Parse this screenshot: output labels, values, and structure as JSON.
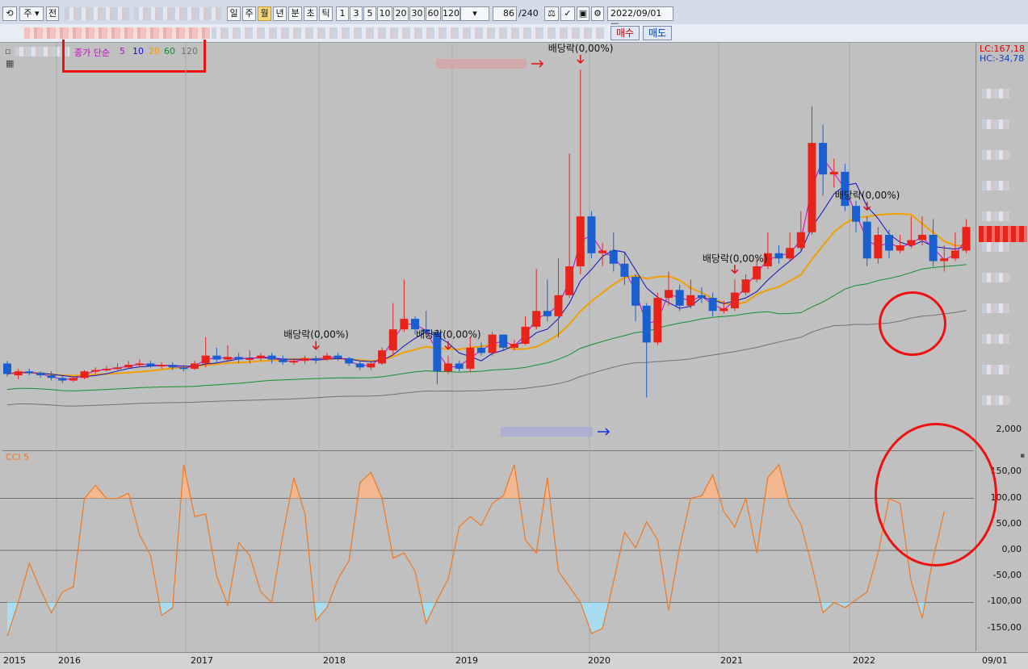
{
  "toolbar": {
    "type_select": "주",
    "prev_label": "전",
    "periods": [
      "일",
      "주",
      "월",
      "년",
      "분",
      "초",
      "틱"
    ],
    "active_period": "월",
    "intervals": [
      "1",
      "3",
      "5",
      "10",
      "20",
      "30",
      "60",
      "120"
    ],
    "count_value": "86",
    "count_total": "/240",
    "date_value": "2022/09/01"
  },
  "order": {
    "buy_label": "매수",
    "sell_label": "매도"
  },
  "legend": {
    "prefix": "종가 단순",
    "ma5": "5",
    "ma10": "10",
    "ma20": "20",
    "ma60": "60",
    "ma120": "120",
    "ma5_color": "#d000d0",
    "ma10_color": "#1010c0",
    "ma20_color": "#f0a000",
    "ma60_color": "#109030",
    "ma120_color": "#707070"
  },
  "readout": {
    "lc": "LC:167,18",
    "hc": "HC:-34,78"
  },
  "price_axis": {
    "bottom_label": "2,000"
  },
  "dividends": [
    {
      "label": "배당락(0,00%)"
    },
    {
      "label": "배당락(0,00%)"
    },
    {
      "label": "배당락(0,00%)"
    },
    {
      "label": "배당락(0,00%)"
    },
    {
      "label": "배당락(0,00%)"
    }
  ],
  "cci": {
    "title": "CCI 5",
    "ticks": [
      "150,00",
      "100,00",
      "50,00",
      "0,00",
      "-50,00",
      "-100,00",
      "-150,00"
    ]
  },
  "x_axis": {
    "labels": [
      "2015",
      "2016",
      "2017",
      "2018",
      "2019",
      "2020",
      "2021",
      "2022"
    ],
    "right_label": "09/01"
  },
  "colors": {
    "up": "#e8231a",
    "down": "#1a5fd0",
    "cci_line": "#f07820",
    "cci_fill_hi": "#f4b890",
    "cci_fill_lo": "#a8dcf0"
  },
  "chart_data": {
    "type": "candlestick",
    "candles": [
      {
        "o": 4.6,
        "c": 4.2,
        "h": 4.7,
        "l": 4.1
      },
      {
        "o": 4.15,
        "c": 4.3,
        "h": 4.4,
        "l": 4.0
      },
      {
        "o": 4.3,
        "c": 4.25,
        "h": 4.4,
        "l": 4.15
      },
      {
        "o": 4.25,
        "c": 4.15,
        "h": 4.3,
        "l": 4.05
      },
      {
        "o": 4.15,
        "c": 4.05,
        "h": 4.3,
        "l": 3.95
      },
      {
        "o": 4.05,
        "c": 3.95,
        "h": 4.15,
        "l": 3.85
      },
      {
        "o": 3.95,
        "c": 4.05,
        "h": 4.1,
        "l": 3.9
      },
      {
        "o": 4.05,
        "c": 4.3,
        "h": 4.35,
        "l": 4.0
      },
      {
        "o": 4.3,
        "c": 4.35,
        "h": 4.45,
        "l": 4.2
      },
      {
        "o": 4.35,
        "c": 4.4,
        "h": 4.5,
        "l": 4.3
      },
      {
        "o": 4.4,
        "c": 4.45,
        "h": 4.6,
        "l": 4.35
      },
      {
        "o": 4.45,
        "c": 4.55,
        "h": 4.7,
        "l": 4.4
      },
      {
        "o": 4.55,
        "c": 4.6,
        "h": 4.75,
        "l": 4.45
      },
      {
        "o": 4.6,
        "c": 4.5,
        "h": 4.7,
        "l": 4.45
      },
      {
        "o": 4.5,
        "c": 4.55,
        "h": 4.65,
        "l": 4.4
      },
      {
        "o": 4.55,
        "c": 4.45,
        "h": 4.65,
        "l": 4.35
      },
      {
        "o": 4.45,
        "c": 4.4,
        "h": 4.55,
        "l": 4.3
      },
      {
        "o": 4.4,
        "c": 4.6,
        "h": 4.7,
        "l": 4.35
      },
      {
        "o": 4.6,
        "c": 4.9,
        "h": 5.6,
        "l": 4.45
      },
      {
        "o": 4.9,
        "c": 4.75,
        "h": 5.2,
        "l": 4.6
      },
      {
        "o": 4.75,
        "c": 4.85,
        "h": 5.3,
        "l": 4.65
      },
      {
        "o": 4.85,
        "c": 4.75,
        "h": 5.0,
        "l": 4.6
      },
      {
        "o": 4.75,
        "c": 4.8,
        "h": 5.1,
        "l": 4.6
      },
      {
        "o": 4.8,
        "c": 4.9,
        "h": 5.0,
        "l": 4.7
      },
      {
        "o": 4.9,
        "c": 4.75,
        "h": 5.0,
        "l": 4.6
      },
      {
        "o": 4.75,
        "c": 4.65,
        "h": 4.9,
        "l": 4.55
      },
      {
        "o": 4.65,
        "c": 4.7,
        "h": 4.8,
        "l": 4.55
      },
      {
        "o": 4.7,
        "c": 4.8,
        "h": 4.9,
        "l": 4.6
      },
      {
        "o": 4.8,
        "c": 4.75,
        "h": 4.9,
        "l": 4.6
      },
      {
        "o": 4.75,
        "c": 4.9,
        "h": 5.0,
        "l": 4.7
      },
      {
        "o": 4.9,
        "c": 4.8,
        "h": 5.0,
        "l": 4.7
      },
      {
        "o": 4.8,
        "c": 4.6,
        "h": 4.85,
        "l": 4.5
      },
      {
        "o": 4.6,
        "c": 4.45,
        "h": 4.7,
        "l": 4.35
      },
      {
        "o": 4.45,
        "c": 4.6,
        "h": 4.65,
        "l": 4.35
      },
      {
        "o": 4.6,
        "c": 5.1,
        "h": 5.2,
        "l": 4.55
      },
      {
        "o": 5.1,
        "c": 5.9,
        "h": 6.9,
        "l": 4.9
      },
      {
        "o": 5.9,
        "c": 6.3,
        "h": 7.8,
        "l": 5.8
      },
      {
        "o": 6.3,
        "c": 5.9,
        "h": 6.4,
        "l": 5.7
      },
      {
        "o": 5.9,
        "c": 5.8,
        "h": 6.6,
        "l": 5.6
      },
      {
        "o": 5.8,
        "c": 4.3,
        "h": 5.9,
        "l": 3.8
      },
      {
        "o": 4.3,
        "c": 4.6,
        "h": 4.9,
        "l": 4.2
      },
      {
        "o": 4.6,
        "c": 4.4,
        "h": 4.7,
        "l": 4.3
      },
      {
        "o": 4.4,
        "c": 5.2,
        "h": 5.6,
        "l": 4.3
      },
      {
        "o": 5.2,
        "c": 5.0,
        "h": 5.4,
        "l": 4.9
      },
      {
        "o": 5.0,
        "c": 5.7,
        "h": 5.8,
        "l": 4.9
      },
      {
        "o": 5.7,
        "c": 5.2,
        "h": 5.7,
        "l": 5.1
      },
      {
        "o": 5.2,
        "c": 5.35,
        "h": 5.5,
        "l": 5.1
      },
      {
        "o": 5.35,
        "c": 6.0,
        "h": 6.4,
        "l": 5.3
      },
      {
        "o": 6.0,
        "c": 6.6,
        "h": 8.2,
        "l": 5.9
      },
      {
        "o": 6.6,
        "c": 6.4,
        "h": 7.8,
        "l": 6.2
      },
      {
        "o": 6.4,
        "c": 7.2,
        "h": 8.6,
        "l": 5.6
      },
      {
        "o": 7.2,
        "c": 8.3,
        "h": 12.6,
        "l": 7.1
      },
      {
        "o": 8.3,
        "c": 10.2,
        "h": 15.8,
        "l": 8.0
      },
      {
        "o": 10.2,
        "c": 8.8,
        "h": 10.4,
        "l": 8.6
      },
      {
        "o": 8.8,
        "c": 8.9,
        "h": 9.2,
        "l": 8.3
      },
      {
        "o": 8.9,
        "c": 8.4,
        "h": 9.6,
        "l": 8.1
      },
      {
        "o": 8.4,
        "c": 7.9,
        "h": 8.8,
        "l": 7.6
      },
      {
        "o": 7.9,
        "c": 6.8,
        "h": 8.0,
        "l": 6.2
      },
      {
        "o": 6.8,
        "c": 5.4,
        "h": 6.9,
        "l": 3.3
      },
      {
        "o": 5.4,
        "c": 7.1,
        "h": 7.3,
        "l": 5.3
      },
      {
        "o": 7.1,
        "c": 7.4,
        "h": 8.1,
        "l": 6.8
      },
      {
        "o": 7.4,
        "c": 6.8,
        "h": 7.6,
        "l": 6.6
      },
      {
        "o": 6.8,
        "c": 7.2,
        "h": 7.8,
        "l": 6.7
      },
      {
        "o": 7.2,
        "c": 7.1,
        "h": 7.5,
        "l": 6.9
      },
      {
        "o": 7.1,
        "c": 6.6,
        "h": 7.3,
        "l": 6.4
      },
      {
        "o": 6.6,
        "c": 6.7,
        "h": 7.0,
        "l": 6.5
      },
      {
        "o": 6.7,
        "c": 7.3,
        "h": 7.8,
        "l": 6.6
      },
      {
        "o": 7.3,
        "c": 7.8,
        "h": 8.0,
        "l": 7.2
      },
      {
        "o": 7.8,
        "c": 8.3,
        "h": 8.6,
        "l": 7.7
      },
      {
        "o": 8.3,
        "c": 8.8,
        "h": 9.6,
        "l": 8.2
      },
      {
        "o": 8.8,
        "c": 8.6,
        "h": 9.1,
        "l": 8.4
      },
      {
        "o": 8.6,
        "c": 9.0,
        "h": 9.6,
        "l": 8.5
      },
      {
        "o": 9.0,
        "c": 9.6,
        "h": 10.4,
        "l": 8.9
      },
      {
        "o": 9.6,
        "c": 13.0,
        "h": 14.4,
        "l": 9.5
      },
      {
        "o": 13.0,
        "c": 11.8,
        "h": 13.7,
        "l": 11.0
      },
      {
        "o": 11.8,
        "c": 11.9,
        "h": 12.4,
        "l": 11.3
      },
      {
        "o": 11.9,
        "c": 10.6,
        "h": 12.2,
        "l": 10.4
      },
      {
        "o": 10.6,
        "c": 10.0,
        "h": 10.8,
        "l": 9.6
      },
      {
        "o": 10.0,
        "c": 8.6,
        "h": 10.2,
        "l": 8.3
      },
      {
        "o": 8.6,
        "c": 9.5,
        "h": 9.8,
        "l": 8.4
      },
      {
        "o": 9.5,
        "c": 8.9,
        "h": 9.7,
        "l": 8.6
      },
      {
        "o": 8.9,
        "c": 9.1,
        "h": 9.5,
        "l": 8.8
      },
      {
        "o": 9.1,
        "c": 9.3,
        "h": 10.2,
        "l": 9.0
      },
      {
        "o": 9.3,
        "c": 9.5,
        "h": 10.2,
        "l": 9.1
      },
      {
        "o": 9.5,
        "c": 8.5,
        "h": 10.1,
        "l": 8.3
      },
      {
        "o": 8.5,
        "c": 8.6,
        "h": 9.1,
        "l": 8.1
      },
      {
        "o": 8.6,
        "c": 8.9,
        "h": 9.6,
        "l": 8.5
      },
      {
        "o": 8.9,
        "c": 9.8,
        "h": 10.1,
        "l": 8.8
      }
    ],
    "cci": [
      -165,
      -100,
      -25,
      -75,
      -120,
      -80,
      -70,
      100,
      125,
      100,
      100,
      110,
      30,
      -10,
      -125,
      -110,
      165,
      65,
      70,
      -50,
      -105,
      15,
      -10,
      -80,
      -100,
      30,
      140,
      70,
      -135,
      -110,
      -55,
      -20,
      130,
      150,
      100,
      -15,
      -5,
      -40,
      -140,
      -95,
      -55,
      45,
      65,
      48,
      90,
      105,
      165,
      20,
      -5,
      140,
      -40,
      -70,
      -100,
      -160,
      -150,
      -60,
      35,
      5,
      55,
      20,
      -115,
      5,
      100,
      105,
      145,
      75,
      45,
      100,
      -5,
      140,
      165,
      85,
      50,
      -30,
      -120,
      -100,
      -110,
      -95,
      -80,
      -5,
      100,
      90,
      -60,
      -130,
      -15,
      75
    ],
    "ma_series": [
      "5",
      "10",
      "20",
      "60",
      "120"
    ]
  }
}
